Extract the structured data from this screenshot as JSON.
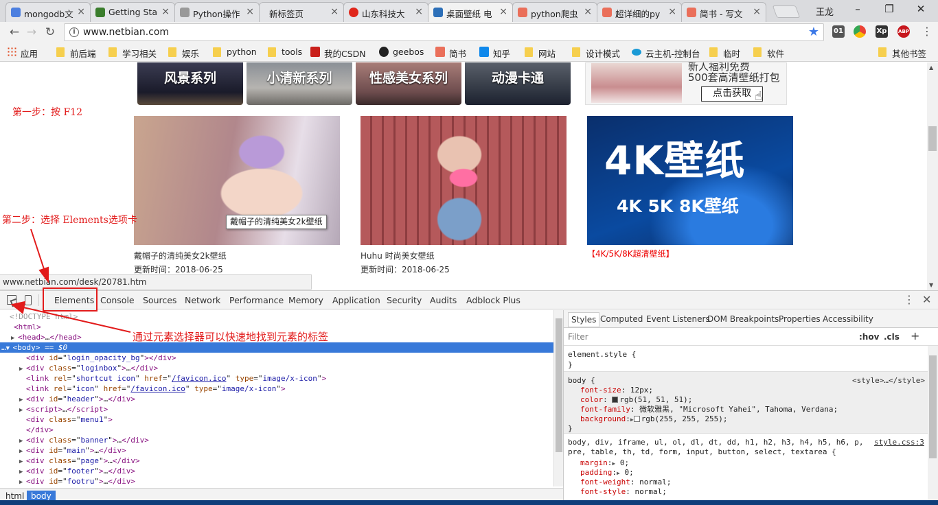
{
  "browser": {
    "tabs": [
      {
        "title": "mongodb文",
        "color": "#4c7fe0"
      },
      {
        "title": "Getting Sta",
        "color": "#3a7d2c"
      },
      {
        "title": "Python操作",
        "color": "#777777"
      },
      {
        "title": "新标签页",
        "color": "#ffffff"
      },
      {
        "title": "山东科技大",
        "color": "#e0261b"
      },
      {
        "title": "桌面壁纸 电",
        "color": "#2c6fb8"
      },
      {
        "title": "python爬虫",
        "color": "#ea6f5a"
      },
      {
        "title": "超详细的py",
        "color": "#ea6f5a"
      },
      {
        "title": "简书 - 写文",
        "color": "#ea6f5a"
      }
    ],
    "user_name": "王龙",
    "url": "www.netbian.com",
    "extensions": [
      {
        "label": "01",
        "color": "#555555"
      },
      {
        "label": "",
        "color": "#3d8eee"
      },
      {
        "label": "Xp",
        "color": "#333333"
      },
      {
        "label": "ABP",
        "color": "#c7171d"
      }
    ],
    "bookmarks": [
      {
        "label": "应用",
        "icon": "apps-grid-icon"
      },
      {
        "label": "前后端",
        "icon": "folder-icon"
      },
      {
        "label": "学习相关",
        "icon": "folder-icon"
      },
      {
        "label": "娱乐",
        "icon": "folder-icon"
      },
      {
        "label": "python",
        "icon": "folder-icon"
      },
      {
        "label": "tools",
        "icon": "folder-icon"
      },
      {
        "label": "我的CSDN",
        "icon": "csdn-icon"
      },
      {
        "label": "geebos",
        "icon": "github-icon"
      },
      {
        "label": "简书",
        "icon": "jianshu-icon"
      },
      {
        "label": "知乎",
        "icon": "zhihu-icon"
      },
      {
        "label": "网站",
        "icon": "folder-icon"
      },
      {
        "label": "设计模式",
        "icon": "folder-icon"
      },
      {
        "label": "云主机-控制台",
        "icon": "cloud-icon"
      },
      {
        "label": "临时",
        "icon": "folder-icon"
      },
      {
        "label": "软件",
        "icon": "folder-icon"
      }
    ],
    "other_bookmarks": "其他书签",
    "status_url": "www.netbian.com/desk/20781.htm"
  },
  "page": {
    "categories": [
      "风景系列",
      "小清新系列",
      "性感美女系列",
      "动漫卡通"
    ],
    "ad": {
      "line1": "新人福利免费",
      "line2": "500套高清壁纸打包",
      "button": "点击获取"
    },
    "items": [
      {
        "title": "戴帽子的清纯美女2k壁纸",
        "updated": "更新时间：2018-06-25"
      },
      {
        "title": "Huhu 时尚美女壁纸",
        "updated": "更新时间：2018-06-25"
      },
      {
        "title": "【4K/5K/8K超清壁纸】",
        "updated": ""
      }
    ],
    "banner_big": "4K壁纸",
    "banner_small": "4K 5K 8K壁纸",
    "tooltip": "戴帽子的清纯美女2k壁纸"
  },
  "annotations": {
    "step1": "第一步：按 F12",
    "step2": "第二步：选择 Elements选项卡",
    "step3": "通过元素选择器可以快速地找到元素的标签",
    "color": "#e21b1b"
  },
  "devtools": {
    "tabs": [
      "Elements",
      "Console",
      "Sources",
      "Network",
      "Performance",
      "Memory",
      "Application",
      "Security",
      "Audits",
      "Adblock Plus"
    ],
    "dom": {
      "doctype": "<!DOCTYPE html>",
      "html": "html",
      "head": "head",
      "body": "body",
      "body_suffix": "== $0",
      "attr_id": "id",
      "attr_class": "class",
      "attr_rel": "rel",
      "attr_href": "href",
      "attr_type": "type",
      "login_opacity_bg": "login_opacity_bg",
      "loginbox": "loginbox",
      "shortcut_icon": "shortcut icon",
      "icon": "icon",
      "favicon": "/favicon.ico",
      "image_type": "image/x-icon",
      "header": "header",
      "script": "script",
      "menu1": "menu1",
      "banner": "banner",
      "main": "main",
      "page": "page",
      "footer": "footer",
      "footru": "footru"
    },
    "breadcrumbs": [
      "html",
      "body"
    ],
    "styles_tabs": [
      "Styles",
      "Computed",
      "Event Listeners",
      "DOM Breakpoints",
      "Properties",
      "Accessibility"
    ],
    "filter_placeholder": "Filter",
    "hov": ":hov",
    "cls": ".cls",
    "rules": {
      "element_style": "element.style {",
      "close": "}",
      "body_selector": "body {",
      "body_source": "<style>…</style>",
      "font_size": [
        "font-size",
        "12px"
      ],
      "color": [
        "color",
        "rgb(51, 51, 51)"
      ],
      "font_family": [
        "font-family",
        "微软雅黑, \"Microsoft Yahei\", Tahoma, Verdana"
      ],
      "background": [
        "background",
        "rgb(255, 255, 255)"
      ],
      "reset_selector1": "body, div, iframe, ul, ol, dl, dt, dd, h1, h2, h3, h4, h5, h6, p,",
      "reset_selector2": "pre, table, th, td, form, input, button, select, textarea {",
      "reset_source": "style.css:3",
      "margin": [
        "margin",
        "0"
      ],
      "padding": [
        "padding",
        "0"
      ],
      "font_weight": [
        "font-weight",
        "normal"
      ],
      "font_style": [
        "font-style",
        "normal"
      ]
    }
  }
}
